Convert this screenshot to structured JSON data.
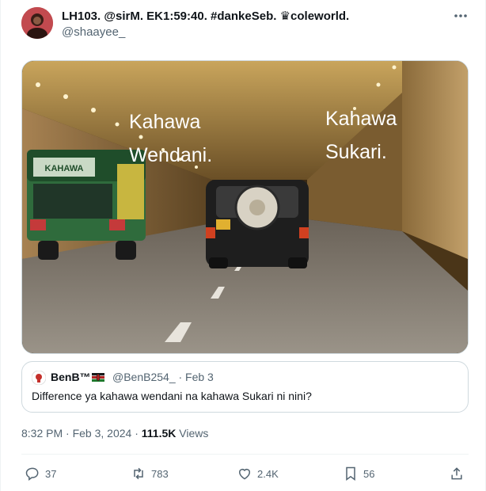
{
  "author": {
    "display_name": "LH103. @sirM. EK1:59:40. #dankeSeb. ♛coleworld.",
    "handle": "@shaayee_"
  },
  "media": {
    "caption_left": [
      "Kahawa",
      "Wendani."
    ],
    "caption_right": [
      "Kahawa",
      "Sukari."
    ],
    "bus_sign": "KAHAWA"
  },
  "quoted_tweet": {
    "name": "BenB™",
    "handle_date": "@BenB254_ · Feb 3",
    "text": "Difference ya kahawa wendani na kahawa Sukari ni nini?"
  },
  "meta": {
    "time_date": "8:32 PM · Feb 3, 2024 · ",
    "views_count": "111.5K",
    "views_label": " Views"
  },
  "actions": {
    "replies": "37",
    "reposts": "783",
    "likes": "2.4K",
    "bookmarks": "56"
  },
  "colors": {
    "text": "#0f1419",
    "secondary": "#536471",
    "border": "#cfd9de"
  }
}
